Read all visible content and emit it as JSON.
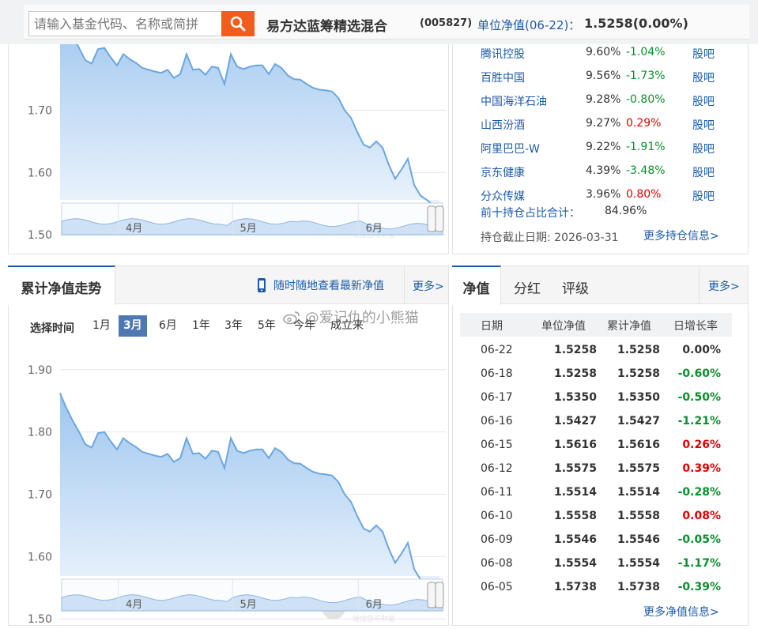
{
  "search": {
    "placeholder": "请输入基金代码、名称或简拼"
  },
  "fund": {
    "name": "易方达蓝筹精选混合",
    "code": "(005827)",
    "nav_label": "单位净值(06-22)：",
    "nav_value": "1.5258(0.00%)"
  },
  "holdings": {
    "rows": [
      {
        "name": "腾讯控股",
        "pct": "9.60%",
        "chg": "-1.04%",
        "link": "股吧",
        "dir": "down"
      },
      {
        "name": "百胜中国",
        "pct": "9.56%",
        "chg": "-1.73%",
        "link": "股吧",
        "dir": "down"
      },
      {
        "name": "中国海洋石油",
        "pct": "9.28%",
        "chg": "-0.80%",
        "link": "股吧",
        "dir": "down"
      },
      {
        "name": "山西汾酒",
        "pct": "9.27%",
        "chg": "0.29%",
        "link": "股吧",
        "dir": "up"
      },
      {
        "name": "阿里巴巴-W",
        "pct": "9.22%",
        "chg": "-1.91%",
        "link": "股吧",
        "dir": "down"
      },
      {
        "name": "京东健康",
        "pct": "4.39%",
        "chg": "-3.48%",
        "link": "股吧",
        "dir": "down"
      },
      {
        "name": "分众传媒",
        "pct": "3.96%",
        "chg": "0.80%",
        "link": "股吧",
        "dir": "up"
      }
    ],
    "top10_label": "前十持仓占比合计：",
    "top10_value": "84.96%",
    "deadline": "持仓截止日期: 2026-03-31",
    "more": "更多持仓信息>"
  },
  "acc_panel": {
    "title": "累计净值走势",
    "mobile_promo": "随时随地查看最新净值",
    "more": "更多>",
    "range_label": "选择时间",
    "ranges": [
      "1月",
      "3月",
      "6月",
      "1年",
      "3年",
      "5年",
      "今年",
      "成立来"
    ],
    "active_range": "3月"
  },
  "watermark": "@爱记仇的小熊猫",
  "chart_brand": {
    "main": "天天基金",
    "sub": "链接您与财富",
    "logo": "基金"
  },
  "nav_panel": {
    "tabs": [
      "净值",
      "分红",
      "评级"
    ],
    "more": "更多>",
    "headers": [
      "日期",
      "单位净值",
      "累计净值",
      "日增长率"
    ],
    "rows": [
      {
        "date": "06-22",
        "unit": "1.5258",
        "acc": "1.5258",
        "chg": "0.00%",
        "dir": "neutral"
      },
      {
        "date": "06-18",
        "unit": "1.5258",
        "acc": "1.5258",
        "chg": "-0.60%",
        "dir": "down"
      },
      {
        "date": "06-17",
        "unit": "1.5350",
        "acc": "1.5350",
        "chg": "-0.50%",
        "dir": "down"
      },
      {
        "date": "06-16",
        "unit": "1.5427",
        "acc": "1.5427",
        "chg": "-1.21%",
        "dir": "down"
      },
      {
        "date": "06-15",
        "unit": "1.5616",
        "acc": "1.5616",
        "chg": "0.26%",
        "dir": "up"
      },
      {
        "date": "06-12",
        "unit": "1.5575",
        "acc": "1.5575",
        "chg": "0.39%",
        "dir": "up"
      },
      {
        "date": "06-11",
        "unit": "1.5514",
        "acc": "1.5514",
        "chg": "-0.28%",
        "dir": "down"
      },
      {
        "date": "06-10",
        "unit": "1.5558",
        "acc": "1.5558",
        "chg": "0.08%",
        "dir": "up"
      },
      {
        "date": "06-09",
        "unit": "1.5546",
        "acc": "1.5546",
        "chg": "-0.05%",
        "dir": "down"
      },
      {
        "date": "06-08",
        "unit": "1.5554",
        "acc": "1.5554",
        "chg": "-1.17%",
        "dir": "down"
      },
      {
        "date": "06-05",
        "unit": "1.5738",
        "acc": "1.5738",
        "chg": "-0.39%",
        "dir": "down"
      }
    ],
    "more_info": "更多净值信息>"
  },
  "chart_data": [
    {
      "type": "area",
      "title": "",
      "xlabel": "",
      "ylabel": "",
      "yticks": [
        "1.70",
        "1.60",
        "1.50"
      ],
      "navigator_labels": [
        "4月",
        "5月",
        "6月"
      ],
      "x": [
        "03-23",
        "03-24",
        "03-25",
        "03-26",
        "03-27",
        "03-30",
        "03-31",
        "04-01",
        "04-02",
        "04-03",
        "04-07",
        "04-08",
        "04-09",
        "04-10",
        "04-13",
        "04-14",
        "04-15",
        "04-16",
        "04-17",
        "04-20",
        "04-21",
        "04-22",
        "04-23",
        "04-24",
        "04-27",
        "04-28",
        "04-29",
        "04-30",
        "05-06",
        "05-07",
        "05-08",
        "05-11",
        "05-12",
        "05-13",
        "05-14",
        "05-15",
        "05-18",
        "05-19",
        "05-20",
        "05-21",
        "05-22",
        "05-25",
        "05-26",
        "05-27",
        "05-28",
        "05-29",
        "06-01",
        "06-02",
        "06-03",
        "06-04",
        "06-05",
        "06-08",
        "06-09",
        "06-10",
        "06-11",
        "06-12",
        "06-15",
        "06-16",
        "06-17",
        "06-18",
        "06-22"
      ],
      "y": [
        1.862,
        1.838,
        1.818,
        1.8,
        1.78,
        1.775,
        1.798,
        1.8,
        1.785,
        1.772,
        1.79,
        1.782,
        1.776,
        1.768,
        1.765,
        1.762,
        1.76,
        1.765,
        1.752,
        1.758,
        1.79,
        1.765,
        1.766,
        1.757,
        1.77,
        1.768,
        1.742,
        1.79,
        1.77,
        1.766,
        1.77,
        1.772,
        1.772,
        1.758,
        1.774,
        1.768,
        1.756,
        1.75,
        1.749,
        1.742,
        1.736,
        1.733,
        1.732,
        1.73,
        1.72,
        1.7,
        1.688,
        1.665,
        1.645,
        1.64,
        1.65,
        1.64,
        1.612,
        1.59,
        1.605,
        1.622,
        1.58,
        1.563,
        1.556,
        1.548,
        1.526
      ],
      "ylim": [
        1.48,
        1.92
      ]
    },
    {
      "type": "area",
      "title": "",
      "xlabel": "",
      "ylabel": "",
      "yticks": [
        "1.90",
        "1.80",
        "1.70",
        "1.60",
        "1.50"
      ],
      "navigator_labels": [
        "4月",
        "5月",
        "6月"
      ],
      "x": [
        "03-23",
        "03-24",
        "03-25",
        "03-26",
        "03-27",
        "03-30",
        "03-31",
        "04-01",
        "04-02",
        "04-03",
        "04-07",
        "04-08",
        "04-09",
        "04-10",
        "04-13",
        "04-14",
        "04-15",
        "04-16",
        "04-17",
        "04-20",
        "04-21",
        "04-22",
        "04-23",
        "04-24",
        "04-27",
        "04-28",
        "04-29",
        "04-30",
        "05-06",
        "05-07",
        "05-08",
        "05-11",
        "05-12",
        "05-13",
        "05-14",
        "05-15",
        "05-18",
        "05-19",
        "05-20",
        "05-21",
        "05-22",
        "05-25",
        "05-26",
        "05-27",
        "05-28",
        "05-29",
        "06-01",
        "06-02",
        "06-03",
        "06-04",
        "06-05",
        "06-08",
        "06-09",
        "06-10",
        "06-11",
        "06-12",
        "06-15",
        "06-16",
        "06-17",
        "06-18",
        "06-22"
      ],
      "y": [
        1.862,
        1.838,
        1.818,
        1.8,
        1.78,
        1.775,
        1.798,
        1.8,
        1.785,
        1.772,
        1.79,
        1.782,
        1.776,
        1.768,
        1.765,
        1.762,
        1.76,
        1.765,
        1.752,
        1.758,
        1.79,
        1.765,
        1.766,
        1.757,
        1.77,
        1.768,
        1.742,
        1.79,
        1.77,
        1.766,
        1.77,
        1.772,
        1.772,
        1.758,
        1.774,
        1.768,
        1.756,
        1.75,
        1.749,
        1.742,
        1.736,
        1.733,
        1.732,
        1.73,
        1.72,
        1.7,
        1.688,
        1.665,
        1.645,
        1.64,
        1.65,
        1.64,
        1.612,
        1.59,
        1.605,
        1.622,
        1.58,
        1.563,
        1.556,
        1.548,
        1.526
      ],
      "ylim": [
        1.48,
        1.92
      ]
    }
  ],
  "colors": {
    "accent": "#1d5aa8",
    "search_button": "#f25c1c",
    "up": "#e10000",
    "down": "#088f2c",
    "area_fill": "#9ec6ef",
    "line": "#6aa6e0",
    "active_range": "#4e78b3"
  }
}
